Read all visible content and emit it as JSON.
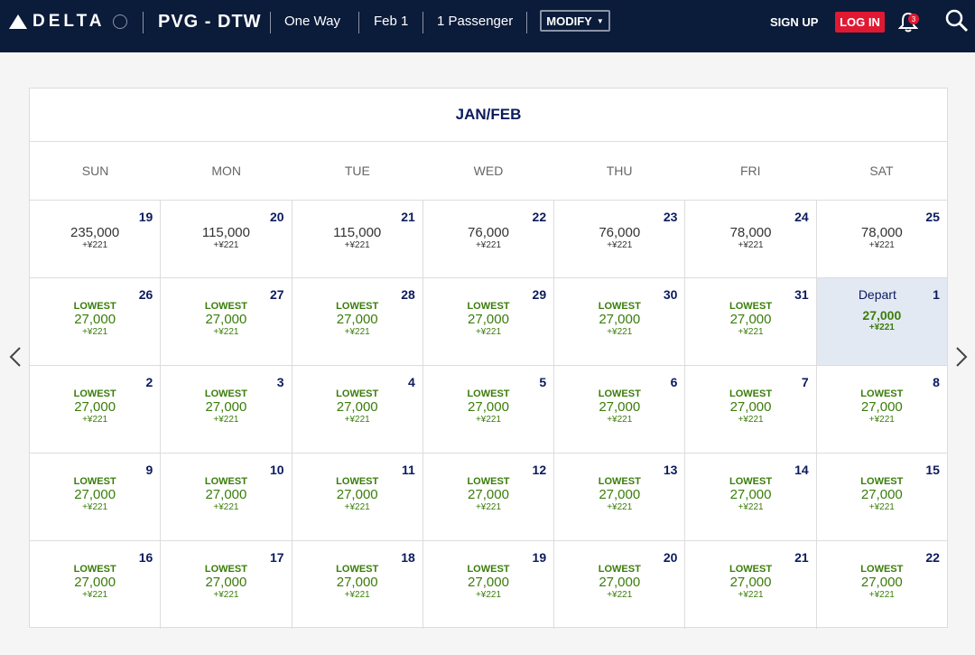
{
  "header": {
    "logo_text": "DELTA",
    "route": "PVG - DTW",
    "trip_type": "One Way",
    "date": "Feb 1",
    "passengers": "1 Passenger",
    "modify_label": "MODIFY",
    "signup_label": "SIGN UP",
    "login_label": "LOG IN",
    "notification_count": "3"
  },
  "calendar": {
    "month_label": "JAN/FEB",
    "weekdays": [
      "SUN",
      "MON",
      "TUE",
      "WED",
      "THU",
      "FRI",
      "SAT"
    ],
    "lowest_label": "LOWEST",
    "depart_label": "Depart",
    "weeks": [
      [
        {
          "day": "19",
          "miles": "235,000",
          "tax": "+¥221",
          "lowest": false
        },
        {
          "day": "20",
          "miles": "115,000",
          "tax": "+¥221",
          "lowest": false
        },
        {
          "day": "21",
          "miles": "115,000",
          "tax": "+¥221",
          "lowest": false
        },
        {
          "day": "22",
          "miles": "76,000",
          "tax": "+¥221",
          "lowest": false
        },
        {
          "day": "23",
          "miles": "76,000",
          "tax": "+¥221",
          "lowest": false
        },
        {
          "day": "24",
          "miles": "78,000",
          "tax": "+¥221",
          "lowest": false
        },
        {
          "day": "25",
          "miles": "78,000",
          "tax": "+¥221",
          "lowest": false
        }
      ],
      [
        {
          "day": "26",
          "miles": "27,000",
          "tax": "+¥221",
          "lowest": true
        },
        {
          "day": "27",
          "miles": "27,000",
          "tax": "+¥221",
          "lowest": true
        },
        {
          "day": "28",
          "miles": "27,000",
          "tax": "+¥221",
          "lowest": true
        },
        {
          "day": "29",
          "miles": "27,000",
          "tax": "+¥221",
          "lowest": true
        },
        {
          "day": "30",
          "miles": "27,000",
          "tax": "+¥221",
          "lowest": true
        },
        {
          "day": "31",
          "miles": "27,000",
          "tax": "+¥221",
          "lowest": true
        },
        {
          "day": "1",
          "miles": "27,000",
          "tax": "+¥221",
          "lowest": false,
          "selected": true
        }
      ],
      [
        {
          "day": "2",
          "miles": "27,000",
          "tax": "+¥221",
          "lowest": true
        },
        {
          "day": "3",
          "miles": "27,000",
          "tax": "+¥221",
          "lowest": true
        },
        {
          "day": "4",
          "miles": "27,000",
          "tax": "+¥221",
          "lowest": true
        },
        {
          "day": "5",
          "miles": "27,000",
          "tax": "+¥221",
          "lowest": true
        },
        {
          "day": "6",
          "miles": "27,000",
          "tax": "+¥221",
          "lowest": true
        },
        {
          "day": "7",
          "miles": "27,000",
          "tax": "+¥221",
          "lowest": true
        },
        {
          "day": "8",
          "miles": "27,000",
          "tax": "+¥221",
          "lowest": true
        }
      ],
      [
        {
          "day": "9",
          "miles": "27,000",
          "tax": "+¥221",
          "lowest": true
        },
        {
          "day": "10",
          "miles": "27,000",
          "tax": "+¥221",
          "lowest": true
        },
        {
          "day": "11",
          "miles": "27,000",
          "tax": "+¥221",
          "lowest": true
        },
        {
          "day": "12",
          "miles": "27,000",
          "tax": "+¥221",
          "lowest": true
        },
        {
          "day": "13",
          "miles": "27,000",
          "tax": "+¥221",
          "lowest": true
        },
        {
          "day": "14",
          "miles": "27,000",
          "tax": "+¥221",
          "lowest": true
        },
        {
          "day": "15",
          "miles": "27,000",
          "tax": "+¥221",
          "lowest": true
        }
      ],
      [
        {
          "day": "16",
          "miles": "27,000",
          "tax": "+¥221",
          "lowest": true
        },
        {
          "day": "17",
          "miles": "27,000",
          "tax": "+¥221",
          "lowest": true
        },
        {
          "day": "18",
          "miles": "27,000",
          "tax": "+¥221",
          "lowest": true
        },
        {
          "day": "19",
          "miles": "27,000",
          "tax": "+¥221",
          "lowest": true
        },
        {
          "day": "20",
          "miles": "27,000",
          "tax": "+¥221",
          "lowest": true
        },
        {
          "day": "21",
          "miles": "27,000",
          "tax": "+¥221",
          "lowest": true
        },
        {
          "day": "22",
          "miles": "27,000",
          "tax": "+¥221",
          "lowest": true
        }
      ]
    ]
  },
  "colors": {
    "header_bg": "#0b1b3a",
    "login_red": "#e01933",
    "lowest_green": "#3a7d0a",
    "navy": "#0b1b5e",
    "selected_bg": "#e3e9f3"
  }
}
